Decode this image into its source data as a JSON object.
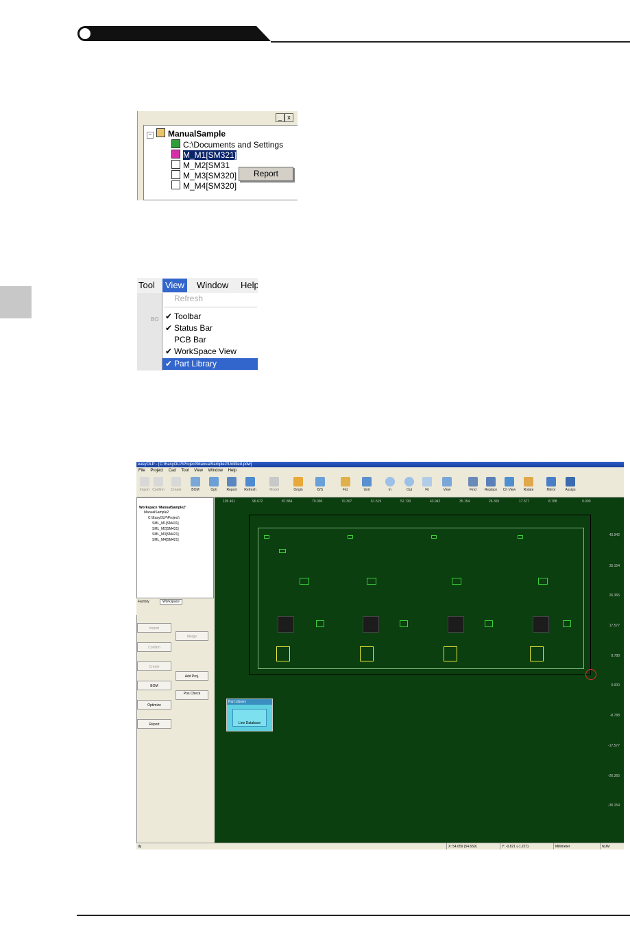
{
  "shot1": {
    "root": "ManualSample",
    "items": [
      "C:\\Documents and Settings",
      "M_M1[SM321]",
      "M_M2[SM31",
      "M_M3[SM320]",
      "M_M4[SM320]"
    ],
    "context_menu": "Report",
    "win_btns": [
      "_",
      "x"
    ]
  },
  "shot2": {
    "menubar": [
      "Tool",
      "View",
      "Window",
      "Help"
    ],
    "items": [
      {
        "label": "Refresh",
        "checked": false,
        "disabled": true
      },
      {
        "label": "Toolbar",
        "checked": true
      },
      {
        "label": "Status Bar",
        "checked": true
      },
      {
        "label": "PCB Bar",
        "checked": false
      },
      {
        "label": "WorkSpace View",
        "checked": true
      },
      {
        "label": "Part Library",
        "checked": true,
        "highlighted": true
      }
    ],
    "check": "✔",
    "bg_label": "BO"
  },
  "app": {
    "title": "easyOLP - [C:\\EasyOLP\\Project\\ManualSample2\\Untitled.pdw]",
    "menu": [
      "File",
      "Project",
      "Cad",
      "Tool",
      "View",
      "Window",
      "Help"
    ],
    "toolbar": [
      "Import",
      "Confirm",
      "Create",
      "BOM",
      "Opti",
      "Report",
      "Refresh",
      "Model",
      "Origin",
      "B/S",
      "Fid.",
      "Unit",
      "In",
      "Out",
      "Fit",
      "View",
      "Find",
      "Replace",
      "Ch View",
      "Rotate",
      "Mirror",
      "Assign"
    ],
    "workspace": {
      "root": "Workspace 'ManualSample2'",
      "project": "ManualSample2",
      "cad": "C:\\EasyOLP\\Project\\",
      "items": [
        "SML_M1[SM431]",
        "SML_M2[SM431]",
        "SML_M3[SM421]",
        "SML_M4[SM421]"
      ],
      "tabs": [
        "Factory",
        "Workspace"
      ]
    },
    "flow": [
      "Import",
      "Confirm",
      "Create",
      "BOM",
      "Optimize",
      "Report",
      "Merge",
      "Add Proj.",
      "Pos Check"
    ],
    "ruler_x": [
      "105.461",
      "96.672",
      "87.884",
      "79.096",
      "70.307",
      "61.519",
      "52.730",
      "43.942",
      "35.154",
      "26.365",
      "17.577",
      "8.788",
      "0.000"
    ],
    "ruler_y": [
      "43.942",
      "35.154",
      "26.365",
      "17.577",
      "8.788",
      "0.000",
      "-8.788",
      "-17.577",
      "-26.365",
      "-35.154"
    ],
    "part_library": {
      "title": "Part Library",
      "db": "Line Database"
    },
    "status": [
      "dy",
      "X: 54.659 (54.659)",
      "Y: -0.821 (-1.227)",
      "Millimeter",
      "NUM"
    ]
  }
}
